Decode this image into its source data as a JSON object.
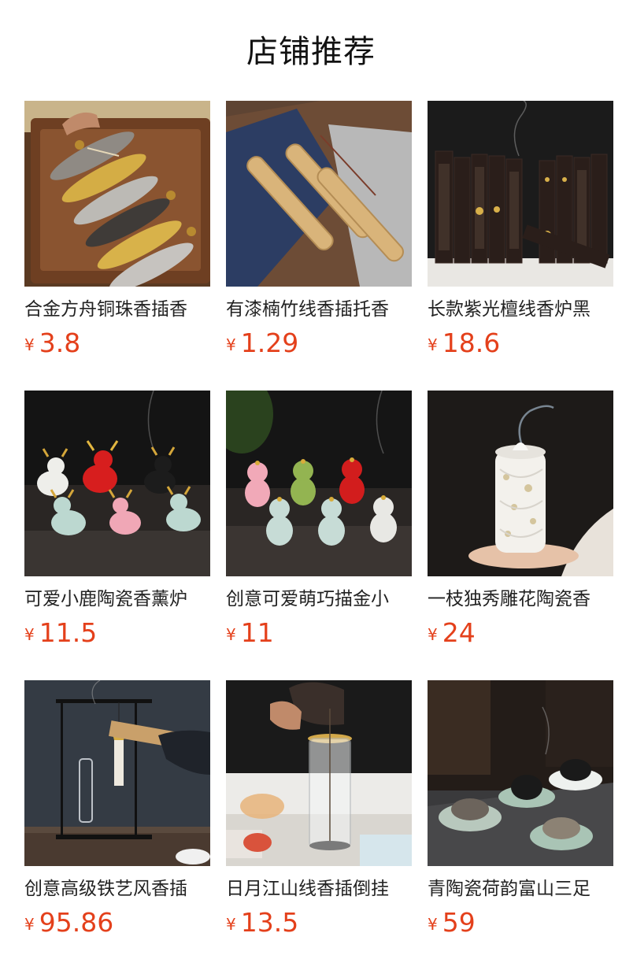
{
  "header": {
    "title": "店铺推荐"
  },
  "currency_symbol": "¥",
  "products": [
    {
      "name": "合金方舟铜珠香插香",
      "price": "3.8",
      "image": "alloy-boat-incense-holders-photo"
    },
    {
      "name": "有漆楠竹线香插托香",
      "price": "1.29",
      "image": "bamboo-incense-trays-photo"
    },
    {
      "name": "长款紫光檀线香炉黑",
      "price": "18.6",
      "image": "dark-wood-incense-boxes-photo"
    },
    {
      "name": "可爱小鹿陶瓷香薰炉",
      "price": "11.5",
      "image": "ceramic-deer-figurines-photo"
    },
    {
      "name": "创意可爱萌巧描金小",
      "price": "11",
      "image": "ceramic-snake-figurines-photo"
    },
    {
      "name": "一枝独秀雕花陶瓷香",
      "price": "24",
      "image": "carved-porcelain-censer-photo"
    },
    {
      "name": "创意高级铁艺风香插",
      "price": "95.86",
      "image": "iron-frame-incense-stand-photo"
    },
    {
      "name": "日月江山线香插倒挂",
      "price": "13.5",
      "image": "glass-tube-incense-holder-photo"
    },
    {
      "name": "青陶瓷荷韵富山三足",
      "price": "59",
      "image": "celadon-lotus-censers-photo"
    }
  ]
}
